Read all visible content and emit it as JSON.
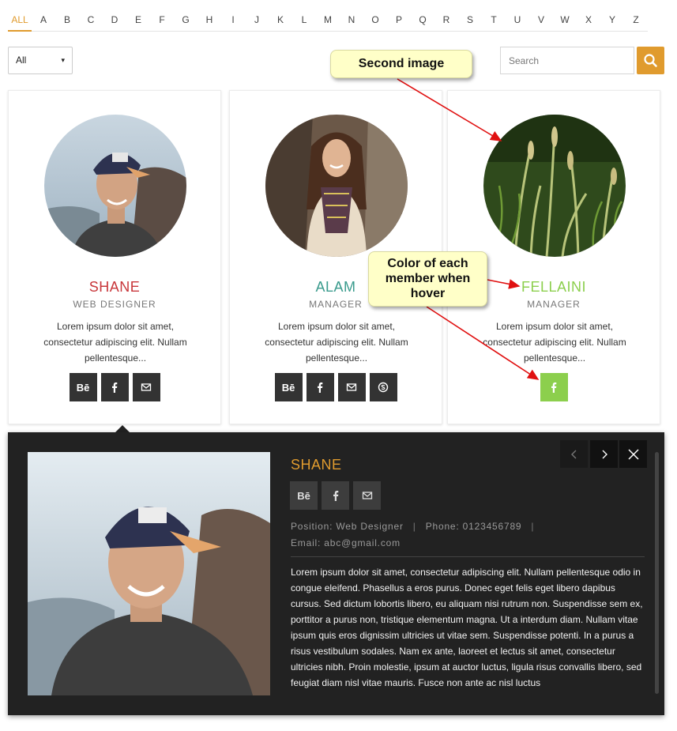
{
  "alphabet": [
    "ALL",
    "A",
    "B",
    "C",
    "D",
    "E",
    "F",
    "G",
    "H",
    "I",
    "J",
    "K",
    "L",
    "M",
    "N",
    "O",
    "P",
    "Q",
    "R",
    "S",
    "T",
    "U",
    "V",
    "W",
    "X",
    "Y",
    "Z"
  ],
  "filter": {
    "selected": "All",
    "caret": "▾"
  },
  "search": {
    "placeholder": "Search"
  },
  "members": [
    {
      "name": "SHANE",
      "role": "WEB DESIGNER",
      "color": "#c8363a",
      "desc": "Lorem ipsum dolor sit amet, consectetur adipiscing elit. Nullam pellentesque...",
      "socials": [
        "behance-icon",
        "facebook-icon",
        "mail-icon"
      ]
    },
    {
      "name": "ALAM",
      "role": "MANAGER",
      "color": "#3a9b8d",
      "desc": "Lorem ipsum dolor sit amet, consectetur adipiscing elit. Nullam pellentesque...",
      "socials": [
        "behance-icon",
        "facebook-icon",
        "mail-icon",
        "skype-icon"
      ]
    },
    {
      "name": "FELLAINI",
      "role": "MANAGER",
      "color": "#8ccf4d",
      "desc": "Lorem ipsum dolor sit amet, consectetur adipiscing elit. Nullam pellentesque...",
      "socials": [
        "facebook-icon"
      ]
    }
  ],
  "social_glyphs": {
    "behance": "Bē"
  },
  "callouts": {
    "second_image": "Second image",
    "hover_color": "Color of each member when hover"
  },
  "detail": {
    "name": "SHANE",
    "position": "Position: Web Designer",
    "phone": "Phone: 0123456789",
    "separator": "|",
    "email": "Email: abc@gmail.com",
    "bio": "Lorem ipsum dolor sit amet, consectetur adipiscing elit. Nullam pellentesque odio in congue eleifend. Phasellus a eros purus. Donec eget felis eget libero dapibus cursus. Sed dictum lobortis libero, eu aliquam nisi rutrum non. Suspendisse sem ex, porttitor a purus non, tristique elementum magna. Ut a interdum diam. Nullam vitae ipsum quis eros dignissim ultricies ut vitae sem. Suspendisse potenti. In a purus a risus vestibulum sodales. Nam ex ante, laoreet et lectus sit amet, consectetur ultricies nibh. Proin molestie, ipsum at auctor luctus, ligula risus convallis libero, sed feugiat diam nisl vitae mauris. Fusce non ante ac nisl luctus"
  },
  "colors": {
    "accent": "#e09b2e",
    "panel_bg": "#222222",
    "button_bg": "#333333",
    "hover_green": "#8ccf4d"
  }
}
